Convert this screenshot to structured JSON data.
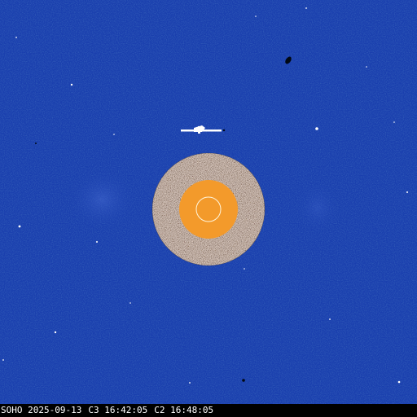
{
  "observatory": "SOHO",
  "date": "2025-09-13",
  "c3": {
    "label": "C3",
    "time": "16:42:05"
  },
  "c2": {
    "label": "C2",
    "time": "16:48:05"
  },
  "colors": {
    "background": "#1a3fae",
    "occulter_ring": "#fff8f0",
    "sun_disk": "#f39a2b",
    "sun_outline": "#fff5dc",
    "footer": "#000000",
    "text": "#ffffff"
  },
  "icons": [
    "pylon-icon",
    "sun-disk-icon",
    "occulter-icon"
  ]
}
